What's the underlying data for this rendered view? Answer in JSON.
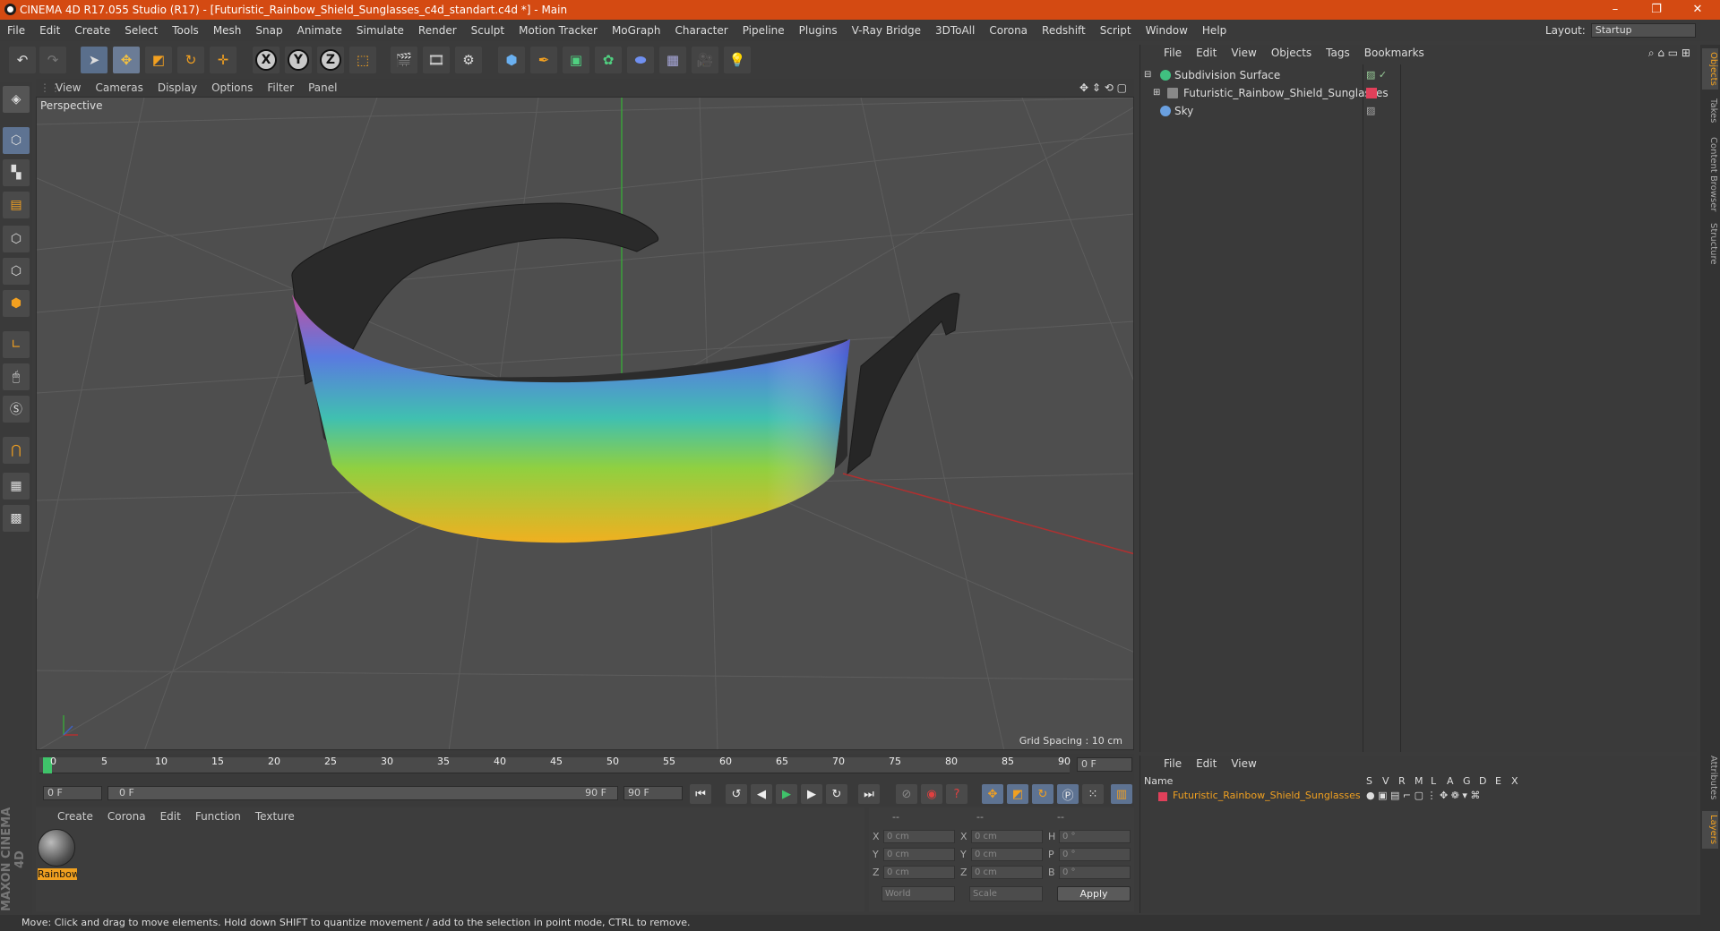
{
  "window": {
    "title": "CINEMA 4D R17.055 Studio (R17) - [Futuristic_Rainbow_Shield_Sunglasses_c4d_standart.c4d *] - Main",
    "minimize": "–",
    "restore": "❐",
    "close": "✕"
  },
  "menubar": [
    "File",
    "Edit",
    "Create",
    "Select",
    "Tools",
    "Mesh",
    "Snap",
    "Animate",
    "Simulate",
    "Render",
    "Sculpt",
    "Motion Tracker",
    "MoGraph",
    "Character",
    "Pipeline",
    "Plugins",
    "V-Ray Bridge",
    "3DToAll",
    "Corona",
    "Redshift",
    "Script",
    "Window",
    "Help"
  ],
  "layout": {
    "label": "Layout:",
    "value": "Startup"
  },
  "toolbar_axes": [
    "X",
    "Y",
    "Z"
  ],
  "viewport": {
    "menu": [
      "View",
      "Cameras",
      "Display",
      "Options",
      "Filter",
      "Panel"
    ],
    "camera_label": "Perspective",
    "grid_spacing": "Grid Spacing : 10 cm"
  },
  "timeline": {
    "ticks": [
      "0",
      "5",
      "10",
      "15",
      "20",
      "25",
      "30",
      "35",
      "40",
      "45",
      "50",
      "55",
      "60",
      "65",
      "70",
      "75",
      "80",
      "85",
      "90"
    ],
    "current_frame": "0 F",
    "start_field": "0 F",
    "range_start": "0 F",
    "range_end": "90 F",
    "end_field": "90 F"
  },
  "material_manager": {
    "menu": [
      "Create",
      "Corona",
      "Edit",
      "Function",
      "Texture"
    ],
    "material_name": "Rainbow"
  },
  "coordinates": {
    "headers": [
      "--",
      "--",
      "--"
    ],
    "rows": [
      {
        "a": "X",
        "av": "0 cm",
        "b": "X",
        "bv": "0 cm",
        "c": "H",
        "cv": "0 °"
      },
      {
        "a": "Y",
        "av": "0 cm",
        "b": "Y",
        "bv": "0 cm",
        "c": "P",
        "cv": "0 °"
      },
      {
        "a": "Z",
        "av": "0 cm",
        "b": "Z",
        "bv": "0 cm",
        "c": "B",
        "cv": "0 °"
      }
    ],
    "world": "World",
    "scale": "Scale",
    "apply": "Apply"
  },
  "object_manager": {
    "menu": [
      "File",
      "Edit",
      "View",
      "Objects",
      "Tags",
      "Bookmarks"
    ],
    "objects": [
      {
        "name": "Subdivision Surface"
      },
      {
        "name": "Futuristic_Rainbow_Shield_Sunglasses"
      },
      {
        "name": "Sky"
      }
    ]
  },
  "layer_manager": {
    "menu": [
      "File",
      "Edit",
      "View"
    ],
    "header_name": "Name",
    "columns": [
      "S",
      "V",
      "R",
      "M",
      "L",
      "A",
      "G",
      "D",
      "E",
      "X"
    ],
    "layer_name": "Futuristic_Rainbow_Shield_Sunglasses"
  },
  "right_tabs": [
    "Objects",
    "Takes",
    "Content Browser",
    "Structure",
    "Attributes",
    "Layers"
  ],
  "status": "Move: Click and drag to move elements. Hold down SHIFT to quantize movement / add to the selection in point mode, CTRL to remove.",
  "brand": "MAXON CINEMA 4D",
  "colors": {
    "titlebar": "#d44a12",
    "accent": "#f0a020",
    "layer": "#e0405a"
  }
}
